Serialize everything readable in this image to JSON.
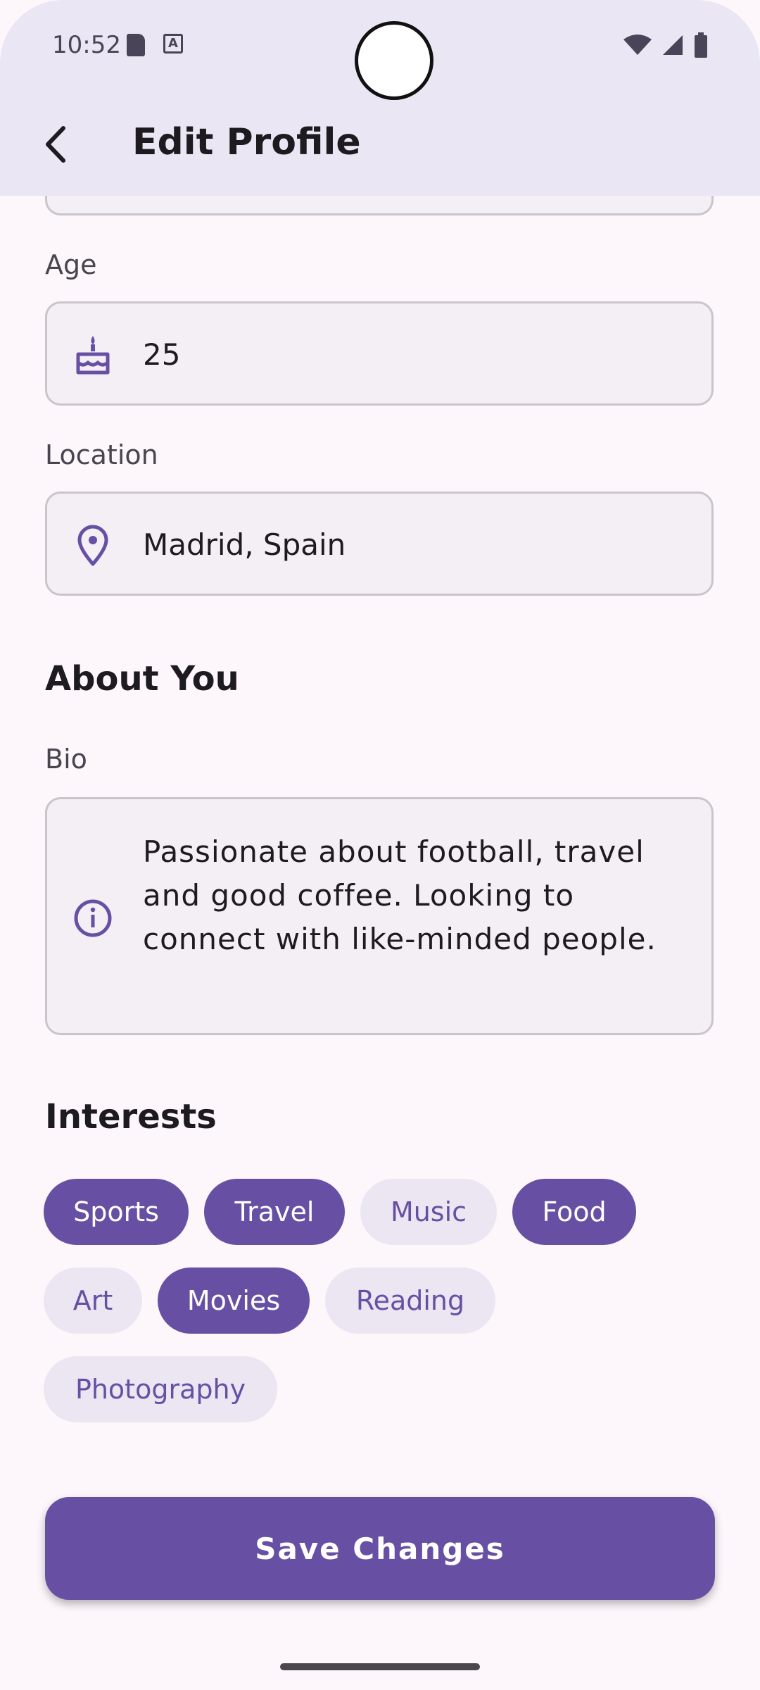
{
  "status_bar": {
    "time": "10:52"
  },
  "app_bar": {
    "title": "Edit Profile"
  },
  "form": {
    "age": {
      "label": "Age",
      "value": "25"
    },
    "location": {
      "label": "Location",
      "value": "Madrid, Spain"
    }
  },
  "about": {
    "title": "About You",
    "bio_label": "Bio",
    "bio_value": "Passionate about football, travel and good coffee. Looking to connect with like-minded people."
  },
  "interests": {
    "title": "Interests",
    "chips": [
      {
        "label": "Sports",
        "selected": true
      },
      {
        "label": "Travel",
        "selected": true
      },
      {
        "label": "Music",
        "selected": false
      },
      {
        "label": "Food",
        "selected": true
      },
      {
        "label": "Art",
        "selected": false
      },
      {
        "label": "Movies",
        "selected": true
      },
      {
        "label": "Reading",
        "selected": false
      },
      {
        "label": "Photography",
        "selected": false
      }
    ]
  },
  "actions": {
    "save_label": "Save Changes"
  },
  "colors": {
    "primary": "#6750a4",
    "chip_unselected_bg": "#ebe6f1",
    "app_bar_bg": "#ebe6f3",
    "background": "#fdf7fc"
  }
}
